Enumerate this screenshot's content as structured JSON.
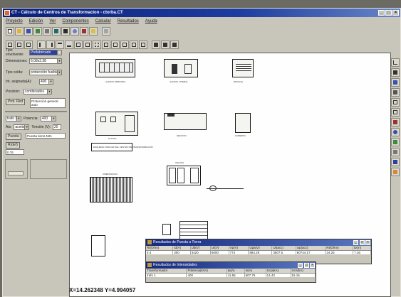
{
  "window": {
    "title": "CT - Cálculo de Centros de Transformacion - ctorba.CT",
    "controls": [
      "_",
      "□",
      "×"
    ]
  },
  "menu": [
    "Proyecto",
    "Edición",
    "Ver",
    "Componentes",
    "Calcular",
    "Resultados",
    "Ayuda"
  ],
  "panel": {
    "tipo_envolvente_label": "Tipo envolvente:",
    "tipo_envolvente_value": "Prefabricado",
    "dimensiones_label": "Dimensiones:",
    "dimensiones_value": "6,08x2,38",
    "tipo_celda_label": "Tipo celda:",
    "tipo_celda_value": "protección fusibles",
    "intensidad_label": "Int. asignada(A):",
    "intensidad_value": "400",
    "posicion_label": "Posición:",
    "posicion_value": "combinados",
    "prot_red_button": "Prot. Red",
    "prot_red_text": "Protección general auto",
    "trafo_value": "trafo 1",
    "potencia_label": "Potencia:",
    "potencia_value": "400",
    "aislamiento_label": "Ais:",
    "aislamiento_value": "aceite",
    "tension_label": "Tensión (V):",
    "tension_value": "20",
    "puesta_button": "Puesta",
    "puesta_tierra_text": "Puesta tierra N21",
    "rstaur_button": "R(def)",
    "rstaur_value": "0.76"
  },
  "drawings": {
    "cap_a": "ALZADO PRINCIPAL",
    "cap_b": "ALZADO LATERAL",
    "cap_c": "DETALLE",
    "cap_d": "PLANTA",
    "cap_e": "SECCION",
    "cap_f": "CUBIERTA",
    "legend": "ESQUEMA UNIFILAR DEL CENTRO DE TRANSFORMACION",
    "cap_g": "CIMENTACION",
    "cap_h": "CELDAS"
  },
  "results_tierra": {
    "title": "Resultados de Puesta a Tierra",
    "headers": [
      "Rt(Ohm)",
      "Id(A)",
      "Ud(V)",
      "Ut(V)",
      "Vp(V)",
      "Upa(V)",
      "Ut(acc)",
      "Up(acc)",
      "Rt(Ohm)",
      "D(m)"
    ],
    "values": [
      "5.4",
      "300",
      "3420",
      "6000",
      "774",
      "884.29",
      "3507.5",
      "60744.17",
      "24.25",
      "7.16"
    ]
  },
  "results_intensidades": {
    "title": "Resultados de Intensidades",
    "headers": [
      "Transformador",
      "Potencia(kVA)",
      "Ip(A)",
      "Is(A)",
      "Iccp(kA)",
      "Iccs(kA)"
    ],
    "values": [
      "trafo 1",
      "400",
      "11.55",
      "607.75",
      "14.43",
      "15.16"
    ]
  },
  "status": "X=14.262348  Y=4.994057"
}
